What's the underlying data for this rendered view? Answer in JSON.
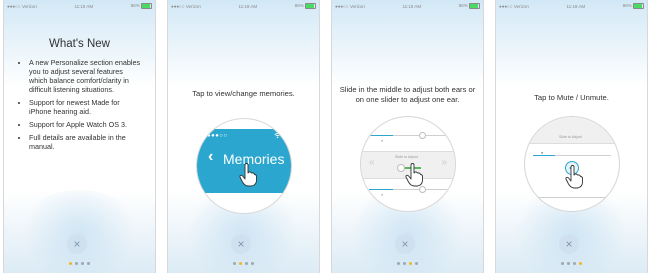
{
  "status_bar": {
    "carrier": "Verizon",
    "time": "11:18 AM",
    "battery": "86%"
  },
  "screens": [
    {
      "title": "What's New",
      "bullets": [
        "A new Personalize section enables you to adjust several features which balance comfort/clarity in difficult listening situations.",
        "Support for newest Made for iPhone hearing aid.",
        "Support for Apple Watch OS 3.",
        "Full details are available in the manual."
      ]
    },
    {
      "caption": "Tap to view/change memories.",
      "circle_label": "Memories"
    },
    {
      "caption": "Slide in the middle to adjust both ears or on one slider to adjust one ear.",
      "slider_hint": "Slide to Adjust"
    },
    {
      "caption": "Tap to Mute / Unmute.",
      "slider_hint": "Slide to Adjust"
    }
  ],
  "colors": {
    "accent": "#2aa6cf",
    "active_dot": "#f4b81e",
    "close_button": "#cfe1ef"
  },
  "close_icon": "×"
}
